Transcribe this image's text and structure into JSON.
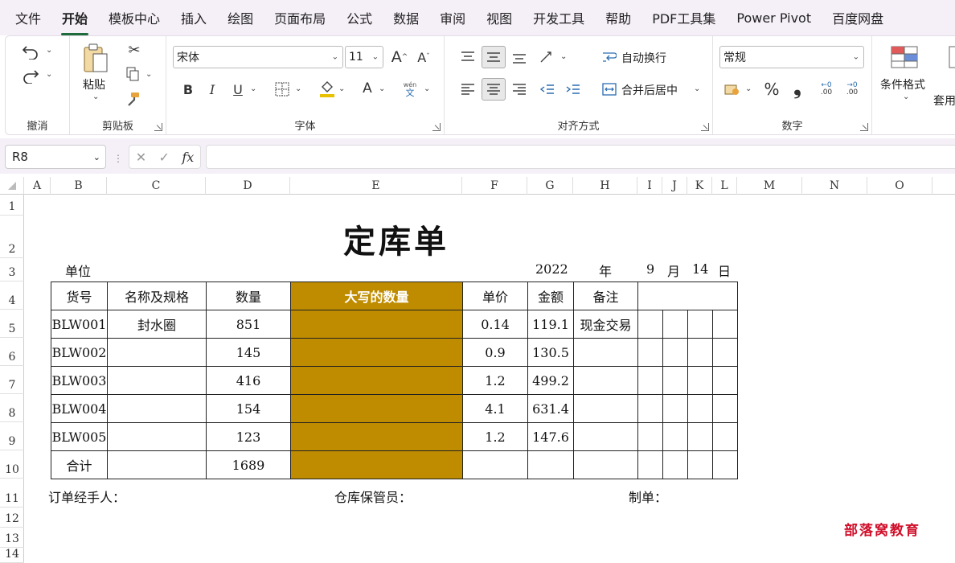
{
  "menu": [
    "文件",
    "开始",
    "模板中心",
    "插入",
    "绘图",
    "页面布局",
    "公式",
    "数据",
    "审阅",
    "视图",
    "开发工具",
    "帮助",
    "PDF工具集",
    "Power Pivot",
    "百度网盘"
  ],
  "ribbon": {
    "undo_label": "撤消",
    "clipboard": {
      "paste": "粘贴",
      "label": "剪贴板"
    },
    "font": {
      "name": "宋体",
      "size": "11",
      "label": "字体",
      "grow": "A",
      "shrink": "A",
      "bold": "B",
      "italic": "I",
      "underline": "U",
      "wen": "wén",
      "wen_char": "文",
      "color_letter": "A"
    },
    "align": {
      "wrap": "自动换行",
      "merge": "合并后居中",
      "label": "对齐方式"
    },
    "number": {
      "format": "常规",
      "label": "数字",
      "percent": "%",
      "comma": "❟",
      "inc": ".00",
      "dec": ".00",
      "inc_small": "←0",
      "dec_small": "→0"
    },
    "styles": {
      "cond": "条件格式",
      "table": "套用表格"
    }
  },
  "formula_bar": {
    "name_box": "R8",
    "fx": "fx",
    "formula": ""
  },
  "columns": [
    "A",
    "B",
    "C",
    "D",
    "E",
    "F",
    "G",
    "H",
    "I",
    "J",
    "K",
    "L",
    "M",
    "N",
    "O"
  ],
  "rows": [
    "1",
    "2",
    "3",
    "4",
    "5",
    "6",
    "7",
    "8",
    "9",
    "10",
    "11",
    "12",
    "13",
    "14"
  ],
  "sheet": {
    "title": "定库单",
    "unit_label": "单位",
    "date": {
      "year": "2022",
      "year_label": "年",
      "month": "9",
      "month_label": "月",
      "day": "14",
      "day_label": "日"
    },
    "headers": [
      "货号",
      "名称及规格",
      "数量",
      "大写的数量",
      "单价",
      "金额",
      "备注"
    ],
    "rows": [
      {
        "code": "BLW001",
        "name": "封水圈",
        "qty": "851",
        "upper": "",
        "price": "0.14",
        "amount": "119.1",
        "note": "现金交易"
      },
      {
        "code": "BLW002",
        "name": "",
        "qty": "145",
        "upper": "",
        "price": "0.9",
        "amount": "130.5",
        "note": ""
      },
      {
        "code": "BLW003",
        "name": "",
        "qty": "416",
        "upper": "",
        "price": "1.2",
        "amount": "499.2",
        "note": ""
      },
      {
        "code": "BLW004",
        "name": "",
        "qty": "154",
        "upper": "",
        "price": "4.1",
        "amount": "631.4",
        "note": ""
      },
      {
        "code": "BLW005",
        "name": "",
        "qty": "123",
        "upper": "",
        "price": "1.2",
        "amount": "147.6",
        "note": ""
      }
    ],
    "total": {
      "label": "合计",
      "qty": "1689"
    },
    "footer": {
      "handler": "订单经手人：",
      "keeper": "仓库保管员：",
      "maker": "制单："
    },
    "watermark": "部落窝教育"
  },
  "colors": {
    "accent": "#1e6b3c",
    "highlight": "#bf8c00",
    "watermark": "#d0102b",
    "chrome": "#f5eff8"
  }
}
